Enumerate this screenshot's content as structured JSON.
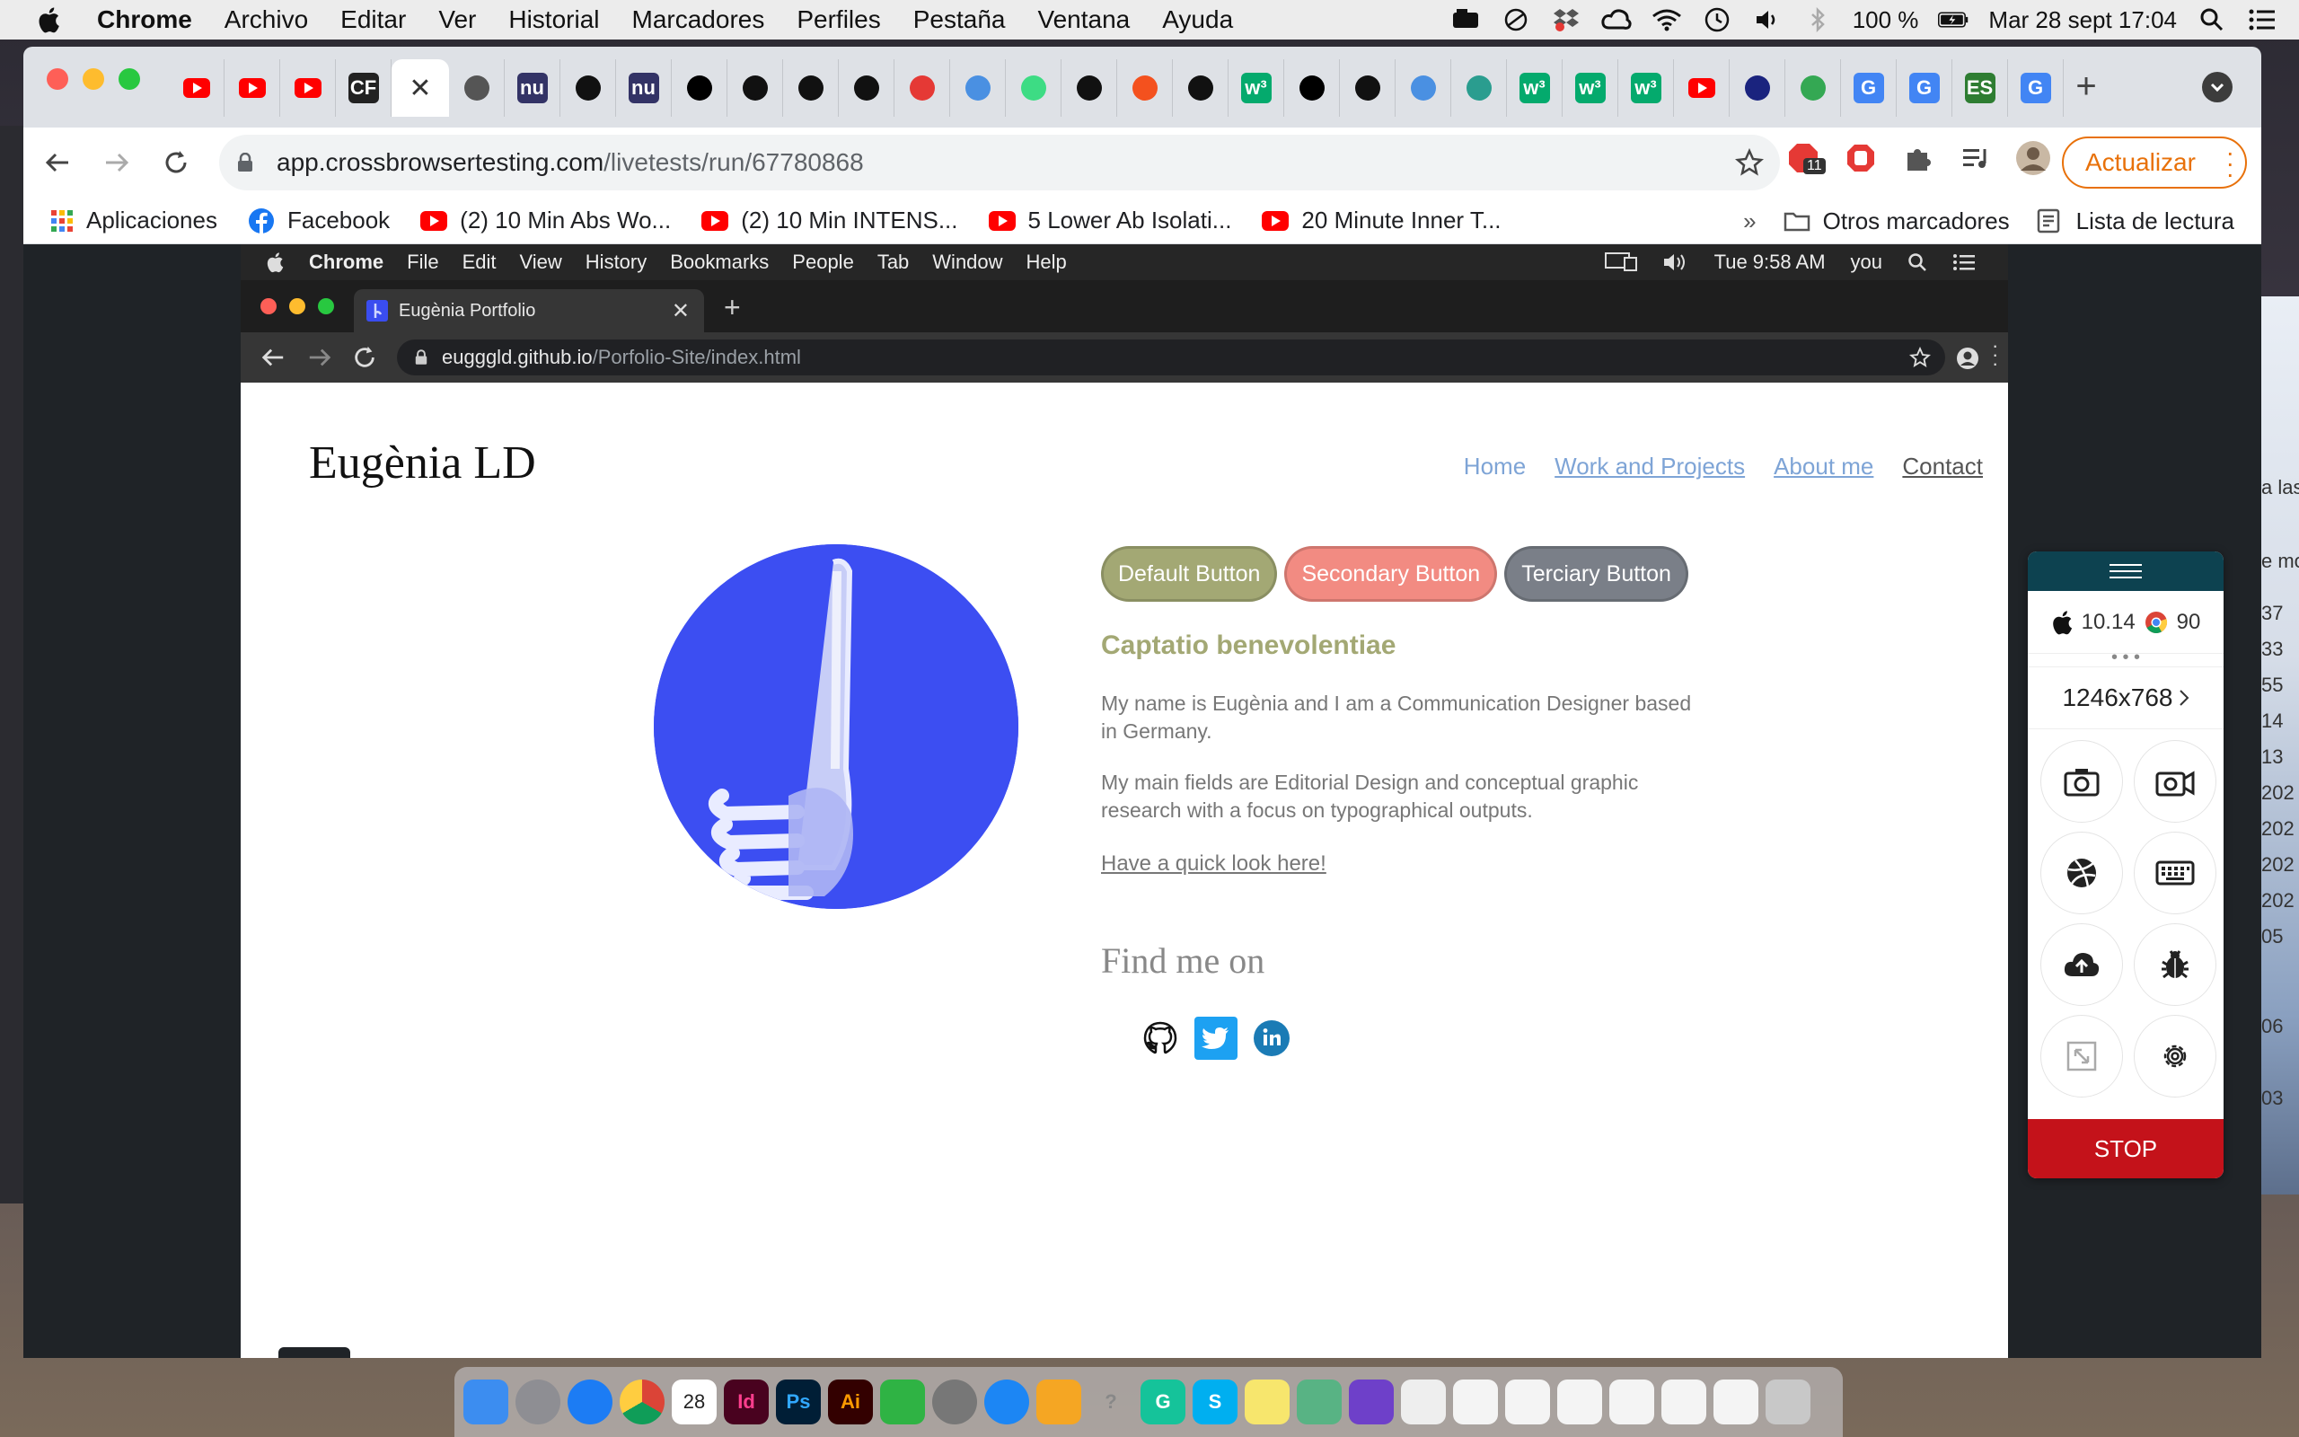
{
  "mac_menubar": {
    "app": "Chrome",
    "items": [
      "Archivo",
      "Editar",
      "Ver",
      "Historial",
      "Marcadores",
      "Perfiles",
      "Pestaña",
      "Ventana",
      "Ayuda"
    ],
    "battery": "100 %",
    "datetime": "Mar 28 sept  17:04"
  },
  "browser": {
    "tabs": [
      {
        "icon": "youtube-icon",
        "color": "#ff0000"
      },
      {
        "icon": "youtube-icon",
        "color": "#ff0000"
      },
      {
        "icon": "youtube-icon",
        "color": "#ff0000"
      },
      {
        "icon": "cf-icon",
        "label": "CF",
        "color": "#222222"
      },
      {
        "icon": "close-icon",
        "active": true
      },
      {
        "icon": "globe-icon",
        "color": "#555555"
      },
      {
        "icon": "nu-icon",
        "label": "nu",
        "color": "#333366"
      },
      {
        "icon": "github-icon",
        "color": "#111111"
      },
      {
        "icon": "nu-icon",
        "label": "nu",
        "color": "#333366"
      },
      {
        "icon": "medium-icon",
        "color": "#000000"
      },
      {
        "icon": "codepen-icon",
        "color": "#111111"
      },
      {
        "icon": "codepen-icon",
        "color": "#111111"
      },
      {
        "icon": "codepen-icon",
        "color": "#111111"
      },
      {
        "icon": "acrobat-icon",
        "color": "#e53935"
      },
      {
        "icon": "cloud-icon",
        "color": "#4a90e2"
      },
      {
        "icon": "android-icon",
        "color": "#3ddc84"
      },
      {
        "icon": "github-icon",
        "color": "#111111"
      },
      {
        "icon": "bag-icon",
        "color": "#f4511e"
      },
      {
        "icon": "codepen-icon",
        "color": "#111111"
      },
      {
        "icon": "w3-icon",
        "label": "w³",
        "color": "#04aa6d"
      },
      {
        "icon": "notion-icon",
        "color": "#000000"
      },
      {
        "icon": "codepen-icon",
        "color": "#111111"
      },
      {
        "icon": "signal-icon",
        "color": "#4a90e2"
      },
      {
        "icon": "magnet-icon",
        "color": "#2a9d8f"
      },
      {
        "icon": "w3-icon",
        "label": "w³",
        "color": "#04aa6d"
      },
      {
        "icon": "w3-icon",
        "label": "w³",
        "color": "#04aa6d"
      },
      {
        "icon": "w3-icon",
        "label": "w³",
        "color": "#04aa6d"
      },
      {
        "icon": "youtube-icon",
        "color": "#ff0000"
      },
      {
        "icon": "info-icon",
        "color": "#1a237e"
      },
      {
        "icon": "maps-icon",
        "color": "#34a853"
      },
      {
        "icon": "google-icon",
        "label": "G",
        "color": "#4285f4"
      },
      {
        "icon": "google-icon",
        "label": "G",
        "color": "#4285f4"
      },
      {
        "icon": "es-icon",
        "label": "ES",
        "color": "#2e7d32"
      },
      {
        "icon": "google-icon",
        "label": "G",
        "color": "#4285f4"
      }
    ],
    "url_host": "app.crossbrowsertesting.com",
    "url_path": "/livetests/run/67780868",
    "update_label": "Actualizar",
    "adblock_badge": "11",
    "bookmarks": [
      {
        "icon": "apps-icon",
        "label": "Aplicaciones"
      },
      {
        "icon": "facebook-icon",
        "label": "Facebook"
      },
      {
        "icon": "youtube-icon",
        "label": "(2) 10 Min Abs Wo..."
      },
      {
        "icon": "youtube-icon",
        "label": "(2) 10 Min INTENS..."
      },
      {
        "icon": "youtube-icon",
        "label": "5 Lower Ab Isolati..."
      },
      {
        "icon": "youtube-icon",
        "label": "20 Minute Inner T..."
      }
    ],
    "more_bookmarks": "»",
    "other_bookmarks": "Otros marcadores",
    "reading_list": "Lista de lectura"
  },
  "remote": {
    "menubar": {
      "app": "Chrome",
      "items": [
        "File",
        "Edit",
        "View",
        "History",
        "Bookmarks",
        "People",
        "Tab",
        "Window",
        "Help"
      ],
      "time": "Tue 9:58 AM",
      "user": "you"
    },
    "tab_title": "Eugènia Portfolio",
    "url_host": "eugggld.github.io",
    "url_path": "/Porfolio-Site/index.html"
  },
  "site": {
    "logo": "Eugènia LD",
    "nav": [
      "Home",
      "Work and Projects",
      "About me",
      "Contact"
    ],
    "buttons": [
      {
        "label": "Default Button",
        "color": "#a3a874"
      },
      {
        "label": "Secondary Button",
        "color": "#f28b82"
      },
      {
        "label": "Terciary Button",
        "color": "#7a7f88"
      }
    ],
    "subtitle": "Captatio benevolentiae",
    "para1": "My name is Eugènia and I am a Communication Designer based in Germany.",
    "para2": "My main fields are Editorial Design and conceptual graphic research with a focus on typographical outputs.",
    "quick_link": "Have a quick look here!",
    "find_me": "Find me on",
    "social": [
      "github-icon",
      "twitter-icon",
      "linkedin-icon"
    ]
  },
  "panel": {
    "os_version": "10.14",
    "browser_version": "90",
    "more": "• • •",
    "resolution": "1246x768",
    "tools": [
      "screenshot-icon",
      "video-icon",
      "dribbble-icon",
      "keyboard-icon",
      "upload-icon",
      "bug-icon",
      "fullscreen-icon",
      "settings-icon"
    ],
    "stop": "STOP"
  },
  "desktop_side_texts": [
    "a las",
    "e mo",
    "37",
    "33",
    "55",
    "14",
    "13",
    "202",
    "202",
    "202",
    "202",
    "05",
    "06",
    "03"
  ],
  "dock": [
    "finder-icon",
    "launchpad-icon",
    "safari-icon",
    "chrome-icon",
    "calendar-icon",
    "indesign-icon",
    "photoshop-icon",
    "illustrator-icon",
    "facetime-icon",
    "preferences-icon",
    "appstore-icon",
    "pages-icon",
    "help-icon",
    "grammarly-icon",
    "skype-icon",
    "notes-icon",
    "atom-icon",
    "github-desktop-icon",
    "textedit-icon",
    "doc-icon",
    "doc-icon",
    "doc-icon",
    "doc-icon",
    "doc-icon",
    "doc-icon",
    "trash-icon"
  ],
  "dock_calendar_day": "28"
}
